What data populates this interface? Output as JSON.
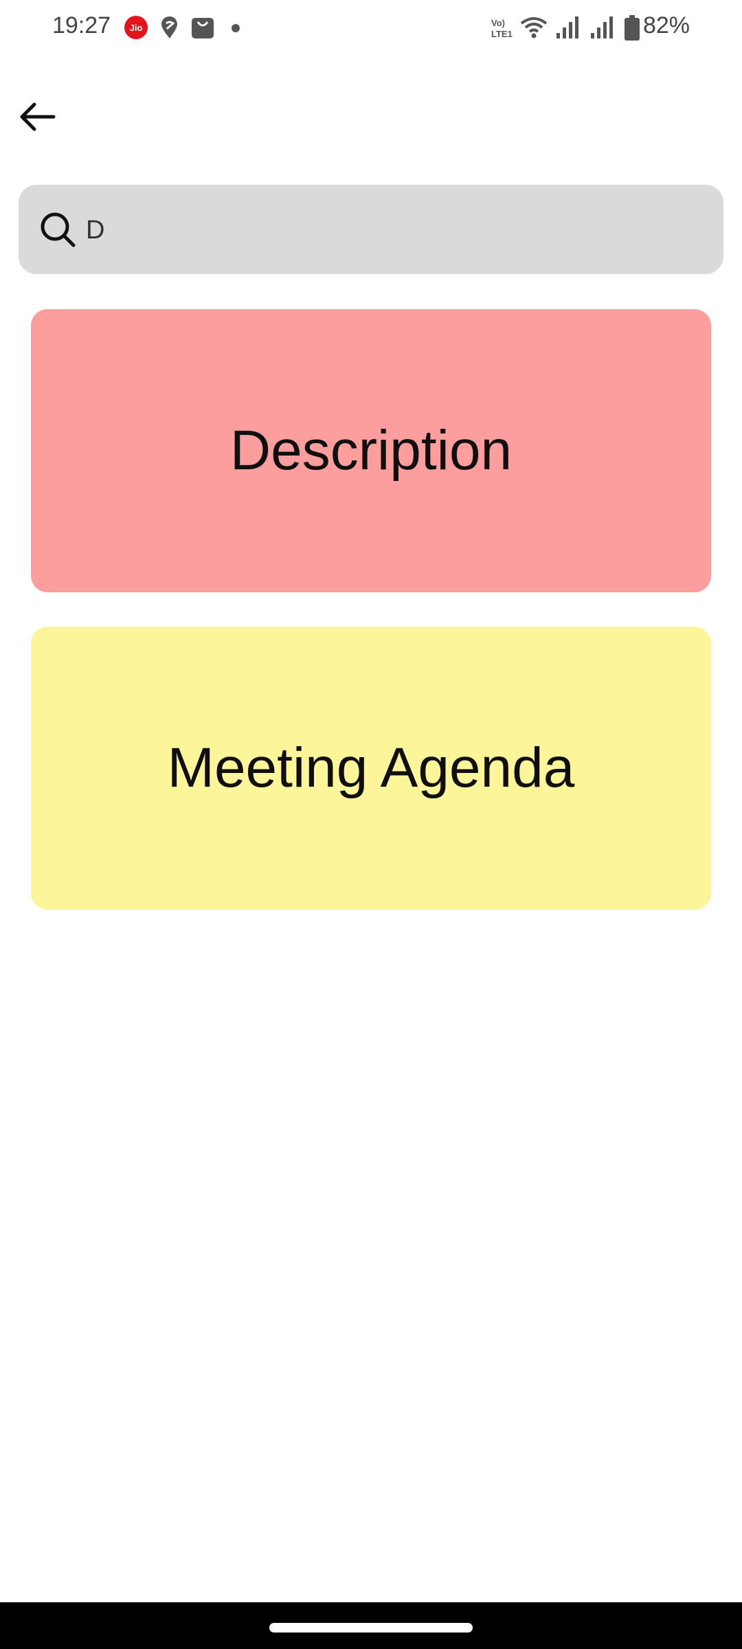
{
  "status_bar": {
    "time": "19:27",
    "battery": "82%",
    "left_icons": [
      "jio-icon",
      "swiggy-icon",
      "shopping-bag-icon",
      "dot-icon"
    ],
    "right_icons": [
      "volte-icon",
      "wifi-icon",
      "signal-icon",
      "signal-icon",
      "battery-icon"
    ],
    "jio_label": "Jio",
    "volte_label": "Vo) LTE1",
    "colors": {
      "jio": "#e4141d",
      "icons": "#555555"
    }
  },
  "header": {
    "back_icon": "arrow-left-icon"
  },
  "search": {
    "icon": "search-icon",
    "value": "D"
  },
  "results": [
    {
      "title": "Description",
      "color": "#fc9e9e"
    },
    {
      "title": "Meeting Agenda",
      "color": "#fdf59a"
    }
  ],
  "colors": {
    "search_bg": "#d9dadb",
    "background": "#ffffff"
  }
}
